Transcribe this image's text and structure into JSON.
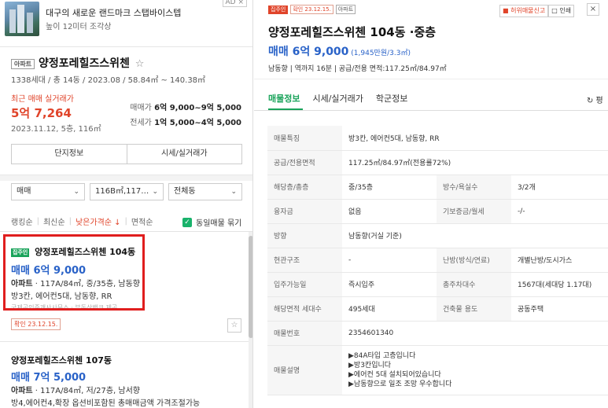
{
  "ad": {
    "title": "대구의 새로운 랜드마크 스탭바이스텝",
    "subtitle": "높이 12미터 조각상",
    "badge": "AD ×"
  },
  "complex": {
    "type_tag": "아파트",
    "name": "양정포레힐즈스위첸",
    "star": "☆",
    "meta": "1338세대 / 총 14동 / 2023.08 / 58.84㎡ ~ 140.38㎡",
    "recent_label": "최근 매매 실거래가",
    "recent_price": "5억 7,264",
    "recent_date": "2023.11.12, 5층, 116㎡",
    "sale_label": "매매가",
    "sale_range": "6억 9,000~9억 5,000",
    "jeonse_label": "전세가",
    "jeonse_range": "1억 5,000~4억 5,000",
    "btn_info": "단지정보",
    "btn_price": "시세/실거래가"
  },
  "filters": {
    "trade": "매매",
    "area": "116B㎡,117…",
    "dong": "전체동",
    "chev": "⌄"
  },
  "sort": {
    "ranking": "랭킹순",
    "latest": "최신순",
    "low_price": "낮은가격순 ↓",
    "area": "면적순",
    "divider": "|",
    "same_listing": "동일매물 묶기",
    "check": "✓"
  },
  "listing1": {
    "badge": "집주인",
    "title": "양정포레힐즈스위첸 104동",
    "price": "매매 6억 9,000",
    "info1_bold": "아파트",
    "info1_rest": " · 117A/84㎡, 중/35층, 남동향",
    "info2": "방3칸, 에어컨5대, 남동향, RR",
    "faded": "국제공인중개사사무소 · 부동산뱅크 제공",
    "confirm": "확인 23.12.15.",
    "star": "☆"
  },
  "listing2": {
    "title": "양정포레힐즈스위첸 107동",
    "price": "매매 7억 5,000",
    "info1_bold": "아파트",
    "info1_rest": " · 117A/84㎡, 저/27층, 남서향",
    "info2": "방4,에어컨4,확장 옵션비포함된 총매매금액 가격조절가능"
  },
  "detail": {
    "badge_owner": "집주인",
    "badge_confirm": "확인 23.12.15.",
    "badge_type": "아파트",
    "report": "■ 허위매물신고",
    "print": "□ 인쇄",
    "close": "×",
    "title": "양정포레힐즈스위첸 104동 ·중층",
    "price": "매매 6억 9,000",
    "price_sub": " (1,945만원/3.3㎡)",
    "meta": "남동향  |  역까지 16분  |  공급/전용 면적:117.25㎡/84.97㎡",
    "tabs": [
      "매물정보",
      "시세/실거래가",
      "학군정보"
    ],
    "refresh": "↻ 평",
    "rows": [
      {
        "k": "매물특징",
        "v": "방3칸, 에어컨5대, 남동향, RR"
      },
      {
        "k": "공급/전용면적",
        "v": "117.25㎡/84.97㎡(전용률72%)"
      },
      {
        "k": "해당층/총층",
        "v": "중/35층",
        "k2": "방수/욕실수",
        "v2": "3/2개"
      },
      {
        "k": "융자금",
        "v": "없음",
        "k2": "기보증금/월세",
        "v2": "-/-"
      },
      {
        "k": "방향",
        "v": "남동향(거실 기준)"
      },
      {
        "k": "현관구조",
        "v": "-",
        "k2": "난방(방식/연료)",
        "v2": "개별난방/도시가스"
      },
      {
        "k": "입주가능일",
        "v": "즉시입주",
        "k2": "총주차대수",
        "v2": "1567대(세대당 1.17대)"
      },
      {
        "k": "해당면적 세대수",
        "v": "495세대",
        "k2": "건축물 용도",
        "v2": "공동주택"
      },
      {
        "k": "매물번호",
        "v": "2354601340"
      }
    ],
    "desc_label": "매물설명",
    "desc": [
      "▶84A타입 고층입니다",
      "▶방3칸입니다",
      "▶에어컨 5대 설치되어있습니다",
      "▶남동향으로 일조 조망 우수합니다"
    ]
  }
}
